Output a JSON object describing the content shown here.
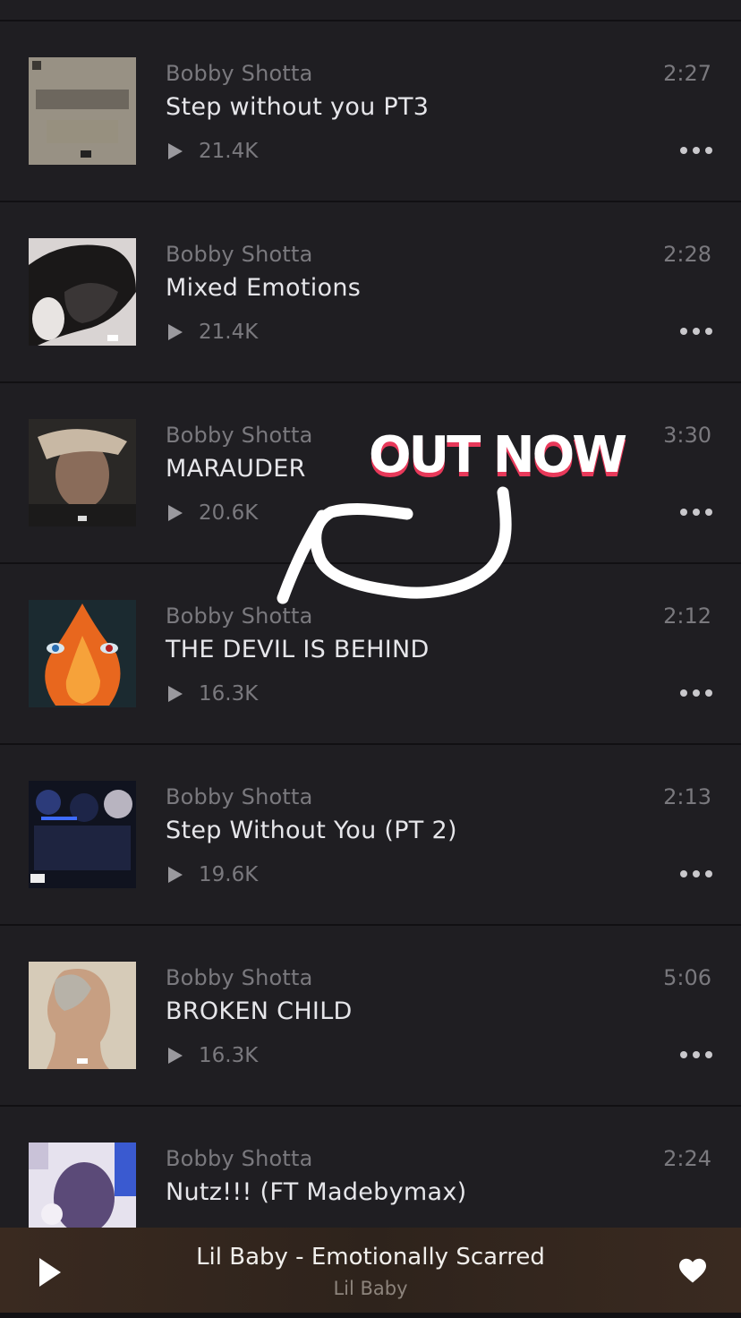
{
  "tracks": [
    {
      "artist": "Bobby Shotta",
      "title": "Step without you PT3",
      "plays": "21.4K",
      "duration": "2:27",
      "artwork": "album-art-collage"
    },
    {
      "artist": "Bobby Shotta",
      "title": "Mixed Emotions",
      "plays": "21.4K",
      "duration": "2:28",
      "artwork": "album-art-dark-figure"
    },
    {
      "artist": "Bobby Shotta",
      "title": "MARAUDER",
      "plays": "20.6K",
      "duration": "3:30",
      "artwork": "album-art-portrait"
    },
    {
      "artist": "Bobby Shotta",
      "title": "THE DEVIL IS BEHIND",
      "plays": "16.3K",
      "duration": "2:12",
      "artwork": "album-art-flame-eyes"
    },
    {
      "artist": "Bobby Shotta",
      "title": "Step Without You (PT 2)",
      "plays": "19.6K",
      "duration": "2:13",
      "artwork": "album-art-group"
    },
    {
      "artist": "Bobby Shotta",
      "title": "BROKEN CHILD",
      "plays": "16.3K",
      "duration": "5:06",
      "artwork": "album-art-profile"
    },
    {
      "artist": "Bobby Shotta",
      "title": "Nutz!!! (FT Madebymax)",
      "plays": "",
      "duration": "2:24",
      "artwork": "album-art-anime"
    }
  ],
  "overlay": {
    "text": "OUT NOW",
    "arrow": "hand-drawn-arrow",
    "colors": {
      "text": "#ffffff",
      "shadow": "#e8395a"
    }
  },
  "now_playing": {
    "title": "Lil Baby - Emotionally Scarred",
    "artist": "Lil Baby",
    "play_icon": "play-icon",
    "like_icon": "heart-icon"
  },
  "icons": {
    "more": "more-options-icon",
    "plays": "play-count-icon"
  }
}
